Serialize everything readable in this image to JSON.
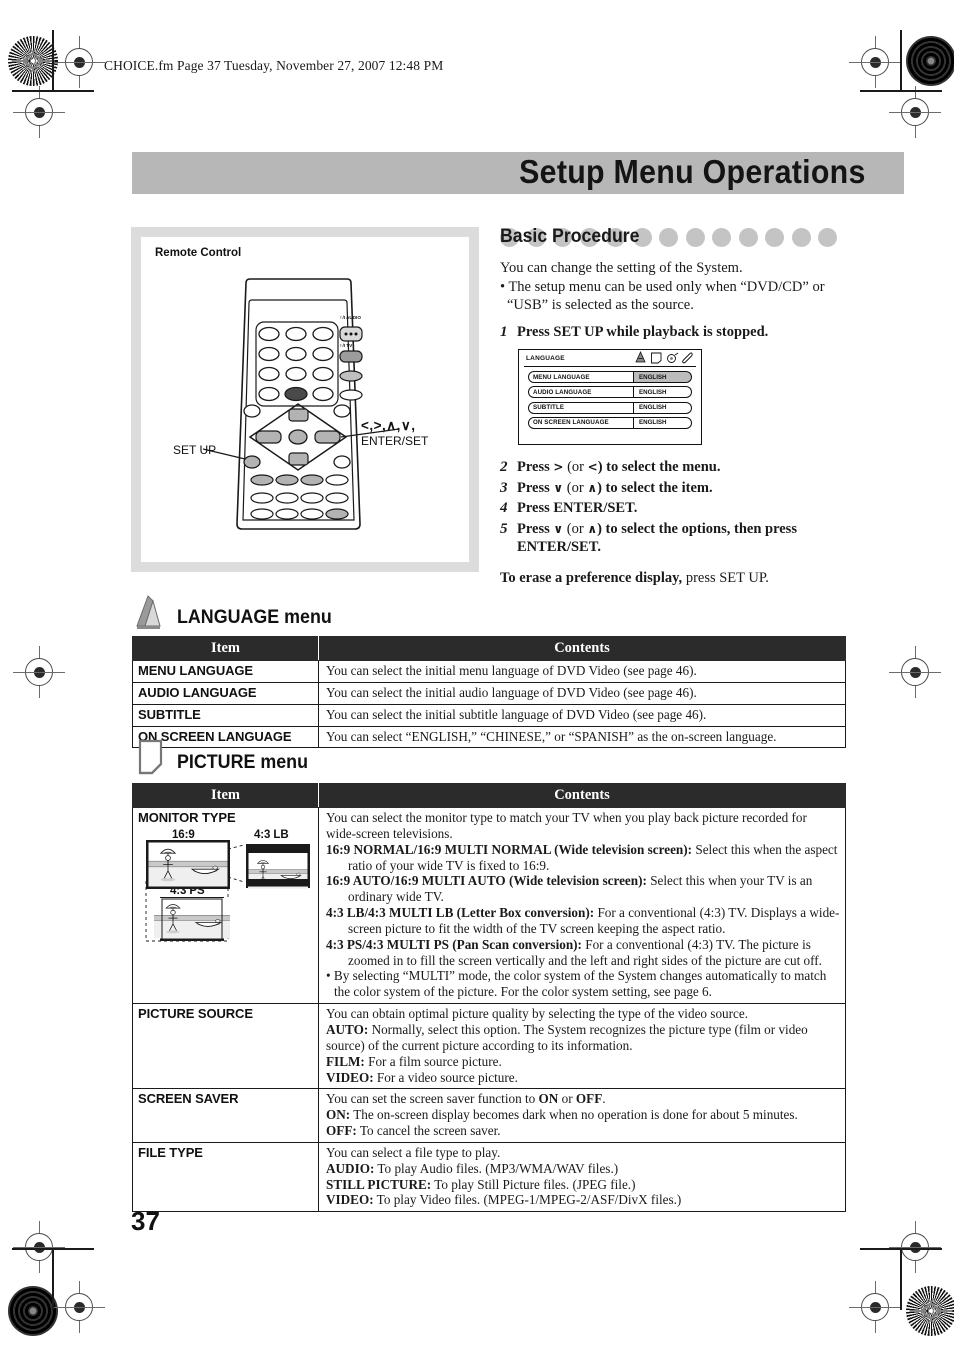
{
  "page": {
    "file_header": "CHOICE.fm  Page 37  Tuesday, November 27, 2007  12:48 PM",
    "title": "Setup Menu Operations",
    "page_number": "37",
    "banner_color": "#b7b7b7",
    "dot_color": "#c4c4c4"
  },
  "remote_panel": {
    "label": "Remote Control",
    "callout_setup": "SET UP",
    "callout_arrows": "<,>,∧,∨,",
    "callout_enterset": "ENTER/SET"
  },
  "basic_procedure": {
    "heading": "Basic Procedure",
    "dot_count": 13,
    "intro": "You can change the setting of the System.",
    "bullet": "• The setup menu can be used only when “DVD/CD” or “USB” is selected as the source.",
    "steps": [
      {
        "num": "1",
        "text": "Press SET UP while playback is stopped."
      },
      {
        "num": "2",
        "pre": "Press ",
        "arrow1": ">",
        "mid": " (or ",
        "arrow2": "<",
        "post": ") to select the menu."
      },
      {
        "num": "3",
        "pre": "Press ",
        "arrow1": "∨",
        "mid": " (or ",
        "arrow2": "∧",
        "post": ") to select the item."
      },
      {
        "num": "4",
        "text": "Press ENTER/SET."
      },
      {
        "num": "5",
        "pre": "Press ",
        "arrow1": "∨",
        "mid": " (or ",
        "arrow2": "∧",
        "post": ") to select the options, then press ENTER/SET."
      }
    ],
    "erase_bold": "To erase a preference display,",
    "erase_rest": " press SET UP."
  },
  "osd_screen": {
    "title": "LANGUAGE",
    "rows": [
      {
        "name": "MENU LANGUAGE",
        "value": "ENGLISH",
        "selected": true
      },
      {
        "name": "AUDIO LANGUAGE",
        "value": "ENGLISH",
        "selected": false
      },
      {
        "name": "SUBTITLE",
        "value": "ENGLISH",
        "selected": false
      },
      {
        "name": "ON SCREEN LANGUAGE",
        "value": "ENGLISH",
        "selected": false
      }
    ]
  },
  "language_menu": {
    "heading": "LANGUAGE menu",
    "col_item": "Item",
    "col_contents": "Contents",
    "rows": [
      {
        "item": "MENU LANGUAGE",
        "contents": "You can select the initial menu language of DVD Video (see page 46)."
      },
      {
        "item": "AUDIO LANGUAGE",
        "contents": "You can select the initial audio language of DVD Video (see page 46)."
      },
      {
        "item": "SUBTITLE",
        "contents": "You can select the initial subtitle language of DVD Video (see page 46)."
      },
      {
        "item": "ON SCREEN LANGUAGE",
        "contents": "You can select “ENGLISH,” “CHINESE,” or “SPANISH” as the on-screen language."
      }
    ]
  },
  "picture_menu": {
    "heading": "PICTURE menu",
    "col_item": "Item",
    "col_contents": "Contents",
    "monitor_type": {
      "item": "MONITOR TYPE",
      "fig_captions": {
        "wide": "16:9",
        "lb": "4:3 LB",
        "ps": "4:3 PS"
      },
      "intro": "You can select the monitor type to match your TV when you play back picture recorded for wide-screen televisions.",
      "options": [
        {
          "label": "16:9 NORMAL/16:9 MULTI NORMAL (Wide television screen):",
          "desc": " Select this when the aspect ratio of your wide TV is fixed to 16:9."
        },
        {
          "label": "16:9 AUTO/16:9 MULTI AUTO (Wide television screen):",
          "desc": " Select this when your TV is an ordinary wide TV."
        },
        {
          "label": "4:3 LB/4:3 MULTI LB (Letter Box conversion):",
          "desc": " For a conventional (4:3) TV. Displays a wide-screen picture to fit the width of the TV screen keeping the aspect ratio."
        },
        {
          "label": "4:3 PS/4:3 MULTI PS (Pan Scan conversion):",
          "desc": " For a conventional (4:3) TV. The picture is zoomed in to fill the screen vertically and the left and right sides of the picture are cut off."
        }
      ],
      "note": "• By selecting “MULTI” mode, the color system of the System changes automatically to match the color system of the picture. For the color system setting, see page 6."
    },
    "picture_source": {
      "item": "PICTURE SOURCE",
      "intro": "You can obtain optimal picture quality by selecting the type of the video source.",
      "options": [
        {
          "label": "AUTO:",
          "desc": " Normally, select this option. The System recognizes the picture type (film or video source) of the current picture according to its information."
        },
        {
          "label": "FILM:",
          "desc": " For a film source picture."
        },
        {
          "label": "VIDEO:",
          "desc": " For a video source picture."
        }
      ]
    },
    "screen_saver": {
      "item": "SCREEN SAVER",
      "intro_pre": "You can set the screen saver function to ",
      "intro_on": "ON",
      "intro_mid": " or ",
      "intro_off": "OFF",
      "intro_post": ".",
      "options": [
        {
          "label": "ON:",
          "desc": " The on-screen display becomes dark when no operation is done for about 5 minutes."
        },
        {
          "label": "OFF:",
          "desc": " To cancel the screen saver."
        }
      ]
    },
    "file_type": {
      "item": "FILE TYPE",
      "intro": "You can select a file type to play.",
      "options": [
        {
          "label": "AUDIO:",
          "desc": " To play Audio files. (MP3/WMA/WAV files.)"
        },
        {
          "label": "STILL PICTURE:",
          "desc": " To play Still Picture files. (JPEG file.)"
        },
        {
          "label": "VIDEO:",
          "desc": " To play Video files. (MPEG-1/MPEG-2/ASF/DivX files.)"
        }
      ]
    }
  }
}
